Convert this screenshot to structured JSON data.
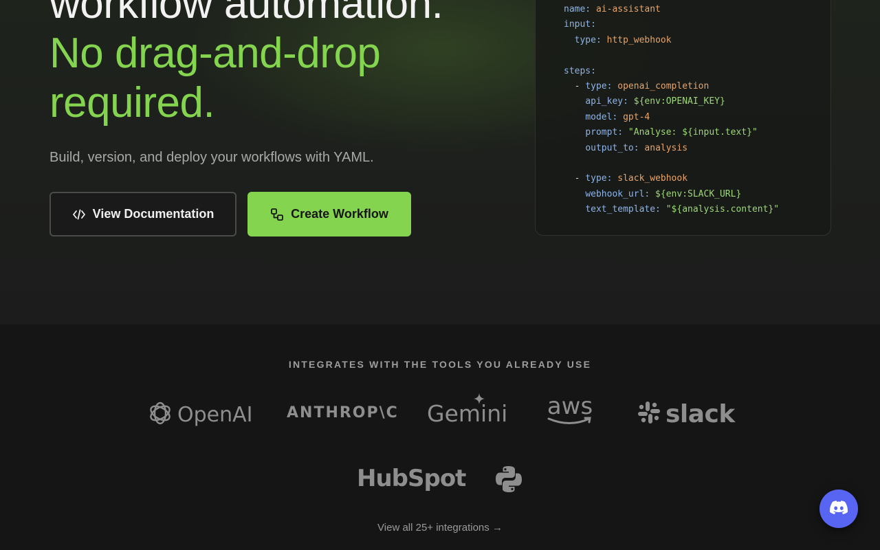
{
  "hero": {
    "headline_line1": "workflow automation.",
    "headline_line2": "No drag-and-drop",
    "headline_line3": "required.",
    "subhead": "Build, version, and deploy your workflows with YAML.",
    "docs_button": "View Documentation",
    "create_button": "Create Workflow"
  },
  "code": {
    "lines": [
      {
        "indent": "",
        "key": "name:",
        "value": " ai-assistant",
        "vclass": "v-orange"
      },
      {
        "indent": "",
        "key": "input:",
        "value": "",
        "vclass": ""
      },
      {
        "indent": "  ",
        "key": "type:",
        "value": " http_webhook",
        "vclass": "v-orange"
      },
      {
        "indent": "",
        "key": "",
        "value": "",
        "vclass": ""
      },
      {
        "indent": "",
        "key": "steps:",
        "value": "",
        "vclass": ""
      },
      {
        "indent": "  - ",
        "key": "type:",
        "value": " openai_completion",
        "vclass": "v-orange"
      },
      {
        "indent": "    ",
        "key": "api_key:",
        "value": " ${env:OPENAI_KEY}",
        "vclass": "v-green"
      },
      {
        "indent": "    ",
        "key": "model:",
        "value": " gpt-4",
        "vclass": "v-orange"
      },
      {
        "indent": "    ",
        "key": "prompt:",
        "value": " \"Analyse: ${input.text}\"",
        "vclass": "v-green"
      },
      {
        "indent": "    ",
        "key": "output_to:",
        "value": " analysis",
        "vclass": "v-orange"
      },
      {
        "indent": "",
        "key": "",
        "value": "",
        "vclass": ""
      },
      {
        "indent": "  - ",
        "key": "type:",
        "value": " slack_webhook",
        "vclass": "v-orange"
      },
      {
        "indent": "    ",
        "key": "webhook_url:",
        "value": " ${env:SLACK_URL}",
        "vclass": "v-green"
      },
      {
        "indent": "    ",
        "key": "text_template:",
        "value": " \"${analysis.content}\"",
        "vclass": "v-green"
      }
    ]
  },
  "integrations": {
    "title": "INTEGRATES WITH THE TOOLS YOU ALREADY USE",
    "logos": {
      "openai": "OpenAI",
      "anthropic": "ANTHROP\\C",
      "gemini": "Gemini",
      "aws": "aws",
      "slack": "slack",
      "hubspot": "HubSpot",
      "python": "python-logo"
    },
    "view_all": "View all 25+ integrations →"
  },
  "colors": {
    "accent": "#84d44f",
    "discord": "#5865f2",
    "background": "#161616"
  },
  "icons": {
    "docs": "code-icon",
    "create": "workflow-icon",
    "floating": "discord-icon"
  }
}
